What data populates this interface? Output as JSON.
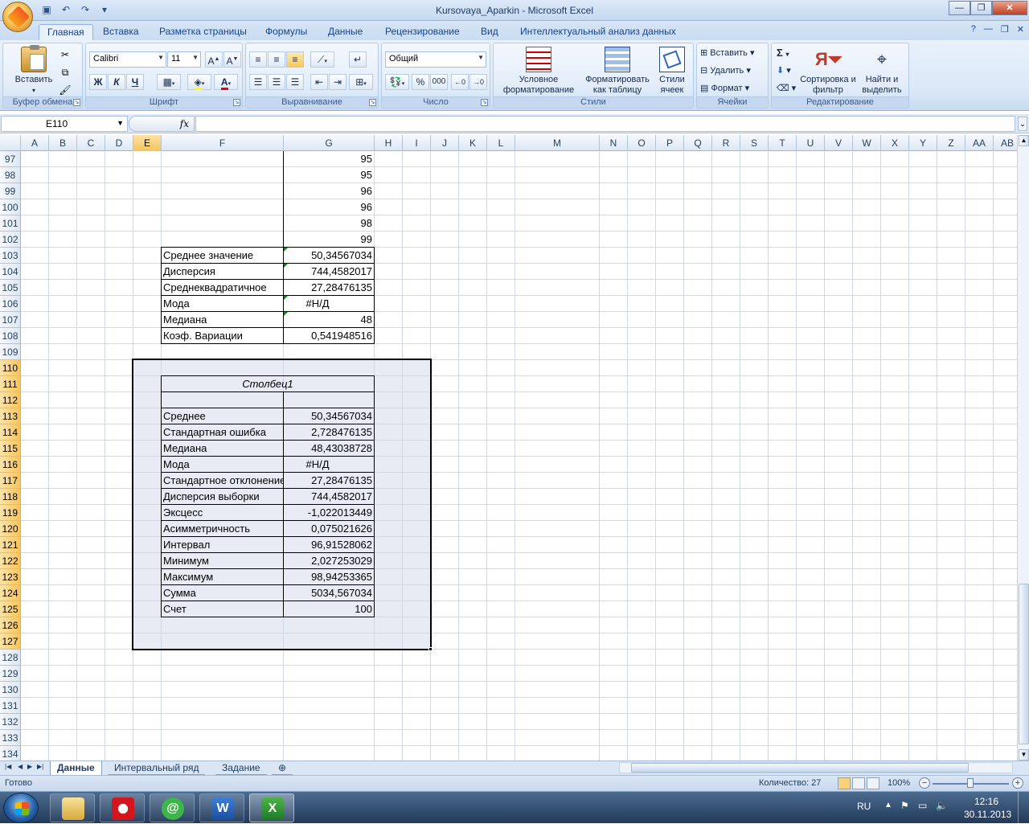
{
  "window": {
    "title": "Kursovaya_Aparkin - Microsoft Excel"
  },
  "qat": {
    "save_icon": "save-icon",
    "undo_icon": "undo-icon",
    "redo_icon": "redo-icon"
  },
  "ribbon_tabs": [
    "Главная",
    "Вставка",
    "Разметка страницы",
    "Формулы",
    "Данные",
    "Рецензирование",
    "Вид",
    "Интеллектуальный анализ данных"
  ],
  "ribbon": {
    "clipboard": {
      "label": "Буфер обмена",
      "paste": "Вставить"
    },
    "font": {
      "label": "Шрифт",
      "name": "Calibri",
      "size": "11",
      "bold": "Ж",
      "italic": "К",
      "underline": "Ч"
    },
    "alignment": {
      "label": "Выравнивание"
    },
    "number": {
      "label": "Число",
      "format": "Общий",
      "percent": "%",
      "thousands": "000"
    },
    "styles": {
      "label": "Стили",
      "conditional": "Условное форматирование",
      "as_table": "Форматировать как таблицу",
      "cell_styles": "Стили ячеек"
    },
    "cells": {
      "label": "Ячейки",
      "insert": "Вставить",
      "delete": "Удалить",
      "format": "Формат"
    },
    "editing": {
      "label": "Редактирование",
      "sort": "Сортировка и фильтр",
      "find": "Найти и выделить",
      "sum": "Σ"
    }
  },
  "formula_bar": {
    "name_box": "E110",
    "fx": "fx",
    "value": ""
  },
  "columns": [
    "A",
    "B",
    "C",
    "D",
    "E",
    "F",
    "G",
    "H",
    "I",
    "J",
    "K",
    "L",
    "M",
    "N",
    "O",
    "P",
    "Q",
    "R",
    "S",
    "T",
    "U",
    "V",
    "W",
    "X",
    "Y",
    "Z",
    "AA",
    "AB"
  ],
  "rows": [
    "97",
    "98",
    "99",
    "100",
    "101",
    "102",
    "103",
    "104",
    "105",
    "106",
    "107",
    "108",
    "109",
    "110",
    "111",
    "112",
    "113",
    "114",
    "115",
    "116",
    "117",
    "118",
    "119",
    "120",
    "121",
    "122",
    "123",
    "124",
    "125",
    "126",
    "127",
    "128",
    "129",
    "130",
    "131",
    "132",
    "133",
    "134"
  ],
  "upper_values": [
    "95",
    "95",
    "96",
    "96",
    "98",
    "99"
  ],
  "stats1": [
    {
      "label": "Среднее значение",
      "value": "50,34567034"
    },
    {
      "label": "Дисперсия",
      "value": "744,4582017"
    },
    {
      "label": "Среднеквадратичное",
      "value": "27,28476135"
    },
    {
      "label": "Мода",
      "value": "#Н/Д"
    },
    {
      "label": "Медиана",
      "value": "48"
    },
    {
      "label": "Коэф. Вариации",
      "value": "0,541948516"
    }
  ],
  "stats2_header": "Столбец1",
  "stats2": [
    {
      "label": "Среднее",
      "value": "50,34567034"
    },
    {
      "label": "Стандартная ошибка",
      "value": "2,728476135"
    },
    {
      "label": "Медиана",
      "value": "48,43038728"
    },
    {
      "label": "Мода",
      "value": "#Н/Д"
    },
    {
      "label": "Стандартное отклонение",
      "value": "27,28476135"
    },
    {
      "label": "Дисперсия выборки",
      "value": "744,4582017"
    },
    {
      "label": "Эксцесс",
      "value": "-1,022013449"
    },
    {
      "label": "Асимметричность",
      "value": "0,075021626"
    },
    {
      "label": "Интервал",
      "value": "96,91528062"
    },
    {
      "label": "Минимум",
      "value": "2,027253029"
    },
    {
      "label": "Максимум",
      "value": "98,94253365"
    },
    {
      "label": "Сумма",
      "value": "5034,567034"
    },
    {
      "label": "Счет",
      "value": "100"
    }
  ],
  "sheet_tabs": [
    "Данные",
    "Интервальный ряд",
    "Задание"
  ],
  "status": {
    "ready": "Готово",
    "count": "Количество: 27",
    "zoom": "100%"
  },
  "taskbar": {
    "lang": "RU",
    "time": "12:16",
    "date": "30.11.2013"
  }
}
